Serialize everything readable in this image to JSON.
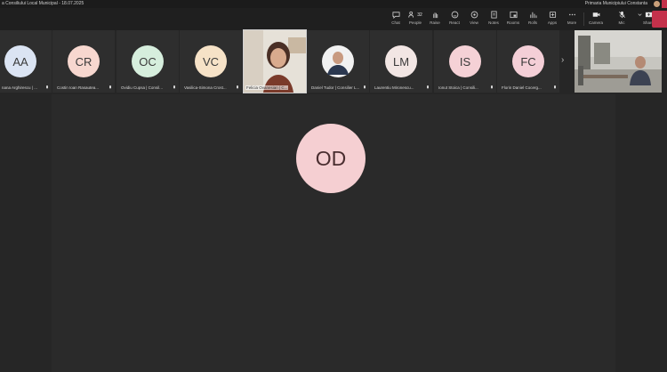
{
  "window": {
    "title": "a Consiliului Local Municipal - 18.07.2025",
    "org_name": "Primaria Municipiului Constanta"
  },
  "toolbar": {
    "chat": "Chat",
    "people": "People",
    "people_count": "32",
    "raise": "Raise",
    "react": "React",
    "view": "View",
    "notes": "Notes",
    "rooms": "Rooms",
    "rolls": "Rolls",
    "apps": "Apps",
    "more": "More",
    "camera": "Camera",
    "mic": "Mic",
    "share": "Share"
  },
  "participants": [
    {
      "initials": "AA",
      "name": "nana Arghirescu | ...",
      "color": "#dbe4f3"
    },
    {
      "initials": "CR",
      "name": "Costin Ioan Rasautea...",
      "color": "#f7d7cf"
    },
    {
      "initials": "OC",
      "name": "Ovidiu Cupsa | Consil...",
      "color": "#d6eedd"
    },
    {
      "initials": "VC",
      "name": "Vasilica-Simona Crost...",
      "color": "#f6e2c7"
    },
    {
      "initials": "",
      "name": "Felicia Ovanesian | C...",
      "color": ""
    },
    {
      "initials": "",
      "name": "Daniel Tudor | Consilier L...",
      "color": ""
    },
    {
      "initials": "LM",
      "name": "Laurentiu Mironescu...",
      "color": "#f2e6e4"
    },
    {
      "initials": "IS",
      "name": "Ionut Stoica | Consili...",
      "color": "#f5d1d6"
    },
    {
      "initials": "FC",
      "name": "Florin Daniel Cocerg...",
      "color": "#f4cfd7"
    }
  ],
  "main": {
    "initials": "OD"
  }
}
